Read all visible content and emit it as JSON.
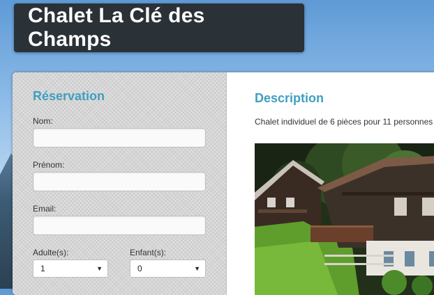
{
  "site": {
    "title": "Chalet La Clé des Champs"
  },
  "reservation": {
    "heading": "Réservation",
    "fields": {
      "nom_label": "Nom:",
      "nom_value": "",
      "prenom_label": "Prénom:",
      "prenom_value": "",
      "email_label": "Email:",
      "email_value": "",
      "adultes_label": "Adulte(s):",
      "adultes_value": "1",
      "enfants_label": "Enfant(s):",
      "enfants_value": "0"
    }
  },
  "description": {
    "heading": "Description",
    "text": "Chalet individuel de 6 pièces pour 11 personnes"
  },
  "colors": {
    "accent": "#3f9fc0",
    "title_bg": "#2a3137"
  },
  "icons": {
    "select_arrow": "chevron-down-icon"
  }
}
